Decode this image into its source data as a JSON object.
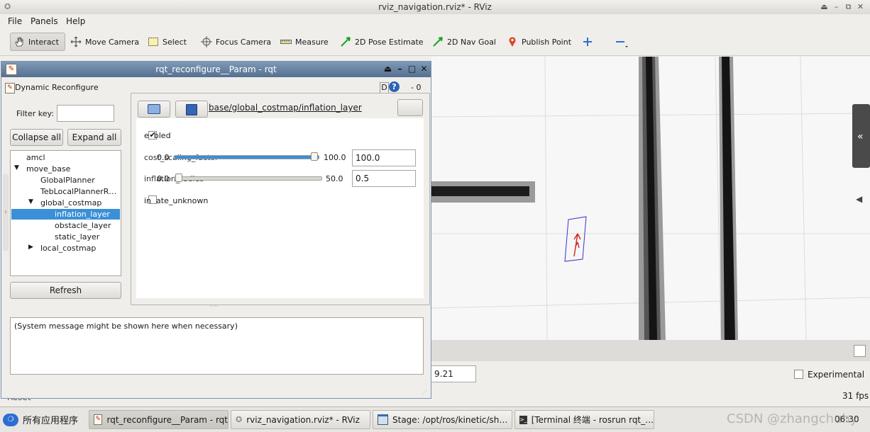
{
  "rviz": {
    "window_title": "rviz_navigation.rviz* - RViz",
    "menus": [
      "File",
      "Panels",
      "Help"
    ],
    "tools": {
      "interact": "Interact",
      "move_camera": "Move Camera",
      "select": "Select",
      "focus_camera": "Focus Camera",
      "measure": "Measure",
      "pose_estimate": "2D Pose Estimate",
      "nav_goal": "2D Nav Goal",
      "publish_point": "Publish Point"
    },
    "time_value": "9.21",
    "experimental_label": "Experimental",
    "fps": "31 fps",
    "reset_label": "Reset"
  },
  "rqt": {
    "window_title": "rqt_reconfigure__Param - rqt",
    "plugin_title": "Dynamic Reconfigure",
    "plugin_badge": "D",
    "plugin_controls": "- 0",
    "filter_label": "Filter key:",
    "filter_value": "",
    "collapse_all": "Collapse all",
    "expand_all": "Expand all",
    "refresh": "Refresh",
    "tree": [
      "amcl",
      "move_base",
      "GlobalPlanner",
      "TebLocalPlannerR…",
      "global_costmap",
      "inflation_layer",
      "obstacle_layer",
      "static_layer",
      "local_costmap"
    ],
    "node_path": "base/global_costmap/inflation_layer",
    "params": {
      "enabled_label": "e  bled",
      "cost_label": "cost_scaling_factor",
      "cost_min": "0.0",
      "cost_max": "100.0",
      "cost_value": "100.0",
      "cost_fraction": 1.0,
      "infl_label": "inflation_radius",
      "infl_min": "0.0",
      "infl_max": "50.0",
      "infl_value": "0.5",
      "infl_fraction": 0.01,
      "inflate_unknown_label": "in  ate_unknown"
    },
    "message": "(System message might be shown here when necessary)"
  },
  "taskbar": {
    "apps_menu": "所有应用程序",
    "tasks": [
      "rqt_reconfigure__Param - rqt",
      "rviz_navigation.rviz* - RViz",
      "Stage: /opt/ros/kinetic/sh…",
      "[Terminal 终端 - rosrun rqt_…"
    ],
    "clock": "06:30",
    "watermark": "CSDN @zhangchuhy"
  },
  "colors": {
    "selection": "#3b8fd6",
    "rqt_title": "#6683a3",
    "robot_outline": "#3b2fd0",
    "robot_arrow": "#d1241a"
  }
}
